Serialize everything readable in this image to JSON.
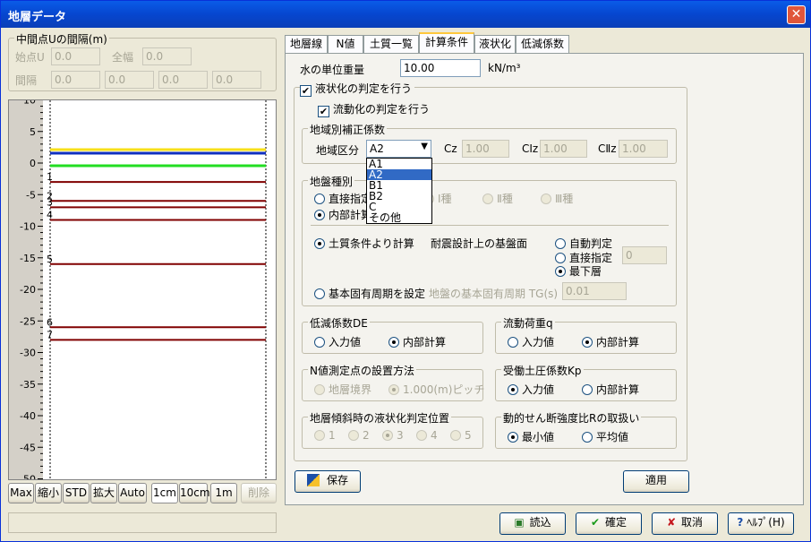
{
  "window": {
    "title": "地層データ",
    "close": "✕"
  },
  "left": {
    "group_title": "中間点Uの間隔(m)",
    "start_label": "始点U",
    "start_value": "0.0",
    "width_label": "全幅",
    "width_value": "0.0",
    "interval_label": "間隔",
    "intervals": [
      "0.0",
      "0.0",
      "0.0",
      "0.0"
    ],
    "axis_ticks": [
      "10",
      "5",
      "0",
      "-5",
      "-10",
      "-15",
      "-20",
      "-25",
      "-30",
      "-35",
      "-40",
      "-45",
      "-50"
    ],
    "layer_labels": [
      "1",
      "2",
      "3",
      "4",
      "5",
      "6",
      "7"
    ],
    "buttons": [
      "Max",
      "縮小",
      "STD",
      "拡大",
      "Auto"
    ],
    "scale_buttons": [
      "1cm",
      "10cm",
      "1m"
    ],
    "delete_button": "削除"
  },
  "tabs": [
    "地層線",
    "N値",
    "土質一覧",
    "計算条件",
    "液状化",
    "低減係数"
  ],
  "form": {
    "unit_weight_label": "水の単位重量",
    "unit_weight_value": "10.00",
    "unit_weight_unit": "kN/m³",
    "liq_check": "液状化の判定を行う",
    "flow_check": "流動化の判定を行う",
    "region_group": "地域別補正係数",
    "region_label": "地域区分",
    "region_value": "A2",
    "cz_label": "Cz",
    "cz_value": "1.00",
    "c1z_label": "CⅠz",
    "c1z_value": "1.00",
    "c2z_label": "CⅡz",
    "c2z_value": "1.00",
    "dropdown_options": [
      "A1",
      "A2",
      "B1",
      "B2",
      "C",
      "その他"
    ],
    "ground_group": "地盤種別",
    "ground_direct": "直接指定",
    "ground_internal": "内部計算",
    "ground_types": [
      "Ⅰ種",
      "Ⅱ種",
      "Ⅲ種"
    ],
    "soil_calc": "土質条件より計算",
    "base_label": "耐震設計上の基盤面",
    "base_auto": "自動判定",
    "base_direct": "直接指定",
    "base_direct_value": "0",
    "base_bottom": "最下層",
    "period_radio": "基本固有周期を設定",
    "period_label": "地盤の基本固有周期 TG(s)",
    "period_value": "0.01",
    "de_group": "低減係数DE",
    "de_input": "入力値",
    "de_internal": "内部計算",
    "q_group": "流動荷重q",
    "q_input": "入力値",
    "q_internal": "内部計算",
    "n_group": "N値測定点の設置方法",
    "n_boundary": "地層境界",
    "n_pitch": "1.000(m)ピッチ",
    "kp_group": "受働土圧係数Kp",
    "kp_input": "入力値",
    "kp_internal": "内部計算",
    "tilt_group": "地層傾斜時の液状化判定位置",
    "tilt_options": [
      "1",
      "2",
      "3",
      "4",
      "5"
    ],
    "r_group": "動的せん断強度比Rの取扱い",
    "r_min": "最小値",
    "r_avg": "平均値",
    "save": "保存",
    "apply": "適用"
  },
  "footer": {
    "read": "読込",
    "ok": "確定",
    "cancel": "取消",
    "help": "ﾍﾙﾌﾟ(H)"
  }
}
